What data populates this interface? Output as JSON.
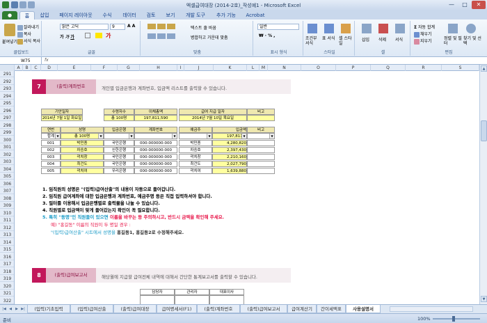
{
  "window": {
    "title": "엑셀급여대장 (2014-2호)_작성예1 - Microsoft Excel",
    "min": "—",
    "max": "□",
    "close": "✕"
  },
  "ribbon_tabs": [
    "홈",
    "삽입",
    "페이지 레이아웃",
    "수식",
    "데이터",
    "검토",
    "보기",
    "개발 도구",
    "추가 기능",
    "Acrobat"
  ],
  "ribbon": {
    "clipboard": {
      "paste": "붙여넣기",
      "cut": "잘라내기",
      "copy": "복사",
      "format_painter": "서식 복사",
      "label": "클립보드"
    },
    "font": {
      "name": "맑은 고딕",
      "size": "9",
      "label": "글꼴"
    },
    "align": {
      "wrap": "텍스트 줄 바꿈",
      "merge": "병합하고 가운데 맞춤",
      "label": "맞춤"
    },
    "number": {
      "format": "일반",
      "label": "표시 형식"
    },
    "style": {
      "cond": "조건부 서식",
      "table": "표 서식",
      "cell": "셀 스타일",
      "label": "스타일"
    },
    "cells": {
      "insert": "삽입",
      "delete": "삭제",
      "format": "서식",
      "label": "셀"
    },
    "edit": {
      "autosum": "자동 합계",
      "fill": "채우기",
      "clear": "지우기",
      "sort": "정렬 및 필터",
      "find": "찾기 및 선택",
      "label": "편집"
    }
  },
  "namebox": "W75",
  "fx": "fx",
  "columns": [
    "A",
    "B",
    "C",
    "D",
    "E",
    "F",
    "G",
    "H",
    "I",
    "J",
    "K",
    "L",
    "M",
    "N",
    "O",
    "P",
    "Q",
    "R",
    "S"
  ],
  "rows": [
    "291",
    "292",
    "293",
    "294",
    "295",
    "296",
    "297",
    "298",
    "299",
    "300",
    "301",
    "302",
    "303",
    "304",
    "305",
    "306",
    "307",
    "308",
    "309",
    "310",
    "311",
    "312",
    "313",
    "314",
    "315",
    "316",
    "317",
    "318",
    "319",
    "320",
    "321",
    "322"
  ],
  "section7": {
    "num": "7",
    "title": "(출력)계좌번호",
    "desc": "개인별 입금은행과 계좌번호, 입금액 리스트를 출력할 수 있습니다.",
    "info_headers": [
      "기안일자",
      "수령자수",
      "이체총액",
      "급여 지급 일자",
      "비고"
    ],
    "info_values": [
      "2014년 7월 1일 화요일",
      "총 100명",
      "197,811,590",
      "2014년 7월 10일 목요일",
      ""
    ],
    "list_headers": [
      "연번",
      "성명",
      "입금은행",
      "계좌번호",
      "예금주",
      "입금액",
      "비고"
    ],
    "summary": [
      "합계",
      "총 100명",
      "",
      "",
      "",
      "197,811,5",
      ""
    ],
    "rows": [
      [
        "001",
        "박민종",
        "국민은행",
        "000-000000-000",
        "박민종",
        "4,280,820",
        ""
      ],
      [
        "002",
        "차승호",
        "신한은행",
        "000-000000-000",
        "차승호",
        "2,397,430",
        ""
      ],
      [
        "003",
        "곽치창",
        "국민은행",
        "000-000000-000",
        "곽치창",
        "2,210,160",
        ""
      ],
      [
        "004",
        "최건도",
        "국민은행",
        "000-000000-000",
        "최건도",
        "2,027,790",
        ""
      ],
      [
        "005",
        "곽치여",
        "우리은행",
        "000-000000-000",
        "곽치여",
        "1,639,880",
        ""
      ]
    ],
    "notes": [
      "1. 임직원의 성명은 \"(입력)급여산출\"의 내용이 자동으로 들어갑니다.",
      "2. 임직원 급여계좌에 대한 입금은행과 계좌번호, 예금주명 등은 직접 입력하셔야 합니다.",
      "3. 필터를 이용해서 입금은행별로 출력물을 나눌 수 있습니다.",
      "4. 직원별로 입금액이 맞게 들어갔는지 확인이 꼭 필요합니다."
    ],
    "note5_a": "5. 특히 \"동명\"인 직원들이 있으면 ",
    "note5_b": "이름을 바꾸는 등 주의하시고, 반드시 금액을 확인해 주세요.",
    "note5_ex": "예) \"홍길동\" 이름의 직원이 두 명일 경우 :",
    "note5_fix_a": "\"(입력)급여산출\" 시트에서 성명을 ",
    "note5_fix_b": "홍길동1, 홍길동2로 수정해주세요."
  },
  "section8": {
    "num": "8",
    "title": "(출력)급여보고서",
    "desc": "해당월에 지급할 급여전체 내역에 대해서 간단한 통계보고서를 출력할 수 있습니다.",
    "approval": [
      "담당자",
      "관리자",
      "대표이사"
    ]
  },
  "sheet_tabs": [
    "(입력)기초입력",
    "(입력)급여산출",
    "(출력)급여대장",
    "급여명세서(F1)",
    "(출력)계좌번호",
    "(출력)급여보고서",
    "급여계산기",
    "간이세액표",
    "사용설명서"
  ],
  "active_sheet": "사용설명서",
  "status": {
    "mode": "준비",
    "zoom": "100%"
  },
  "colors": {
    "accent": "#c2185b",
    "header_fill": "#efe8b0",
    "input_fill": "#ffffa0",
    "ribbon": "#dde8f5"
  }
}
